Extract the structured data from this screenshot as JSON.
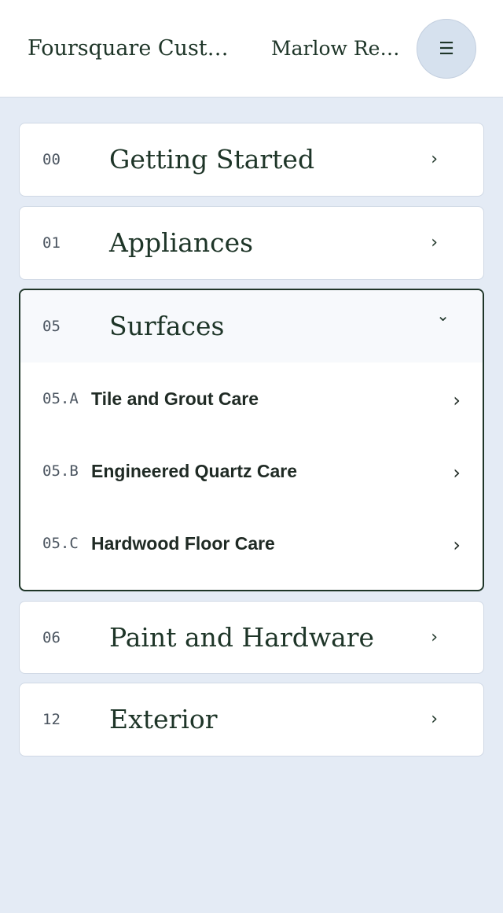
{
  "header": {
    "brand": "Foursquare Custom Homes",
    "project": "Marlow Residence",
    "menu_icon": "☰"
  },
  "sections": [
    {
      "number": "00",
      "title": "Getting Started",
      "chevron": "›"
    },
    {
      "number": "01",
      "title": "Appliances",
      "chevron": "›"
    },
    {
      "number": "05",
      "title": "Surfaces",
      "chevron": "⌄",
      "items": [
        {
          "number": "05.A",
          "title": "Tile and Grout Care",
          "chevron": "›"
        },
        {
          "number": "05.B",
          "title": "Engineered Quartz Care",
          "chevron": "›"
        },
        {
          "number": "05.C",
          "title": "Hardwood Floor Care",
          "chevron": "›"
        }
      ]
    },
    {
      "number": "06",
      "title": "Paint and Hardware",
      "chevron": "›"
    },
    {
      "number": "12",
      "title": "Exterior",
      "chevron": "›"
    }
  ]
}
